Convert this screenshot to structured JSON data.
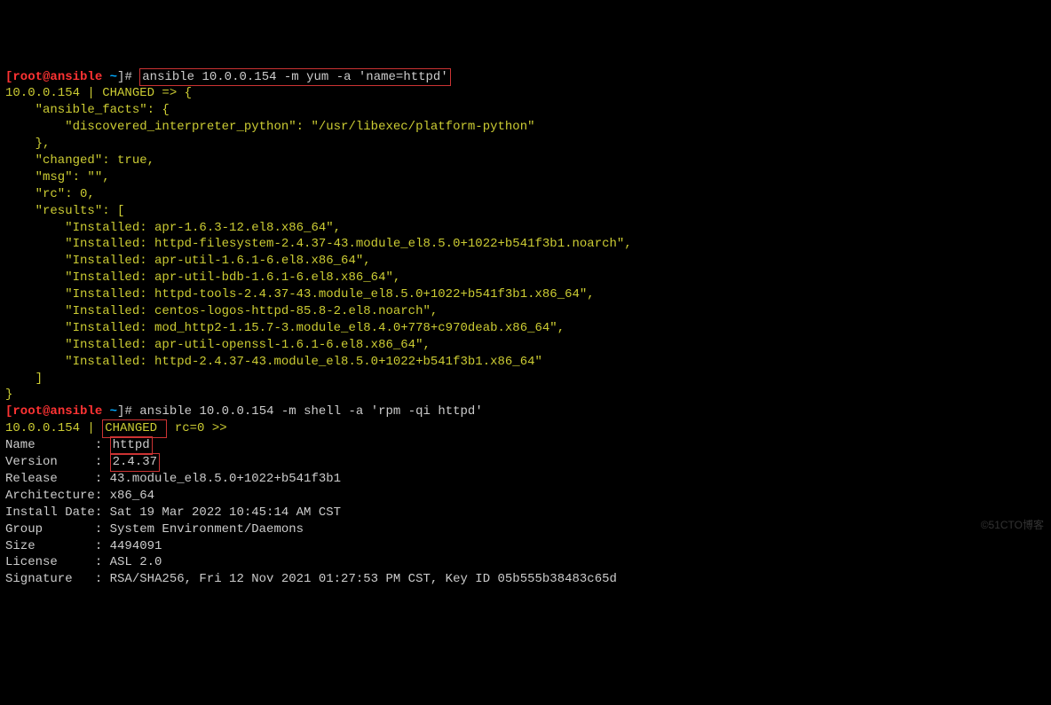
{
  "prompt1": {
    "user_host": "root@ansible",
    "cwd": "~",
    "hash": "]#",
    "command": "ansible 10.0.0.154 -m yum -a 'name=httpd'"
  },
  "output1": {
    "header": "10.0.0.154 | CHANGED => {",
    "l1": "    \"ansible_facts\": {",
    "l2": "        \"discovered_interpreter_python\": \"/usr/libexec/platform-python\"",
    "l3": "    },",
    "l4": "    \"changed\": true,",
    "l5": "    \"msg\": \"\",",
    "l6": "    \"rc\": 0,",
    "l7": "    \"results\": [",
    "r0": "        \"Installed: apr-1.6.3-12.el8.x86_64\",",
    "r1": "        \"Installed: httpd-filesystem-2.4.37-43.module_el8.5.0+1022+b541f3b1.noarch\",",
    "r2": "        \"Installed: apr-util-1.6.1-6.el8.x86_64\",",
    "r3": "        \"Installed: apr-util-bdb-1.6.1-6.el8.x86_64\",",
    "r4": "        \"Installed: httpd-tools-2.4.37-43.module_el8.5.0+1022+b541f3b1.x86_64\",",
    "r5": "        \"Installed: centos-logos-httpd-85.8-2.el8.noarch\",",
    "r6": "        \"Installed: mod_http2-1.15.7-3.module_el8.4.0+778+c970deab.x86_64\",",
    "r7": "        \"Installed: apr-util-openssl-1.6.1-6.el8.x86_64\",",
    "r8": "        \"Installed: httpd-2.4.37-43.module_el8.5.0+1022+b541f3b1.x86_64\"",
    "l9": "    ]",
    "l10": "}"
  },
  "prompt2": {
    "user_host": "root@ansible",
    "cwd": "~",
    "hash": "]#",
    "command": "ansible 10.0.0.154 -m shell -a 'rpm -qi httpd'"
  },
  "output2": {
    "header_pre": "10.0.0.154 | ",
    "header_box": "CHANGED ",
    "header_post": " rc=0 >>",
    "name_label": "Name        : ",
    "name_value": "httpd",
    "version_label": "Version     : ",
    "version_value": "2.4.37",
    "release": "Release     : 43.module_el8.5.0+1022+b541f3b1",
    "arch": "Architecture: x86_64",
    "install_date": "Install Date: Sat 19 Mar 2022 10:45:14 AM CST",
    "group": "Group       : System Environment/Daemons",
    "size": "Size        : 4494091",
    "license": "License     : ASL 2.0",
    "signature": "Signature   : RSA/SHA256, Fri 12 Nov 2021 01:27:53 PM CST, Key ID 05b555b38483c65d"
  },
  "watermark": "©51CTO博客"
}
